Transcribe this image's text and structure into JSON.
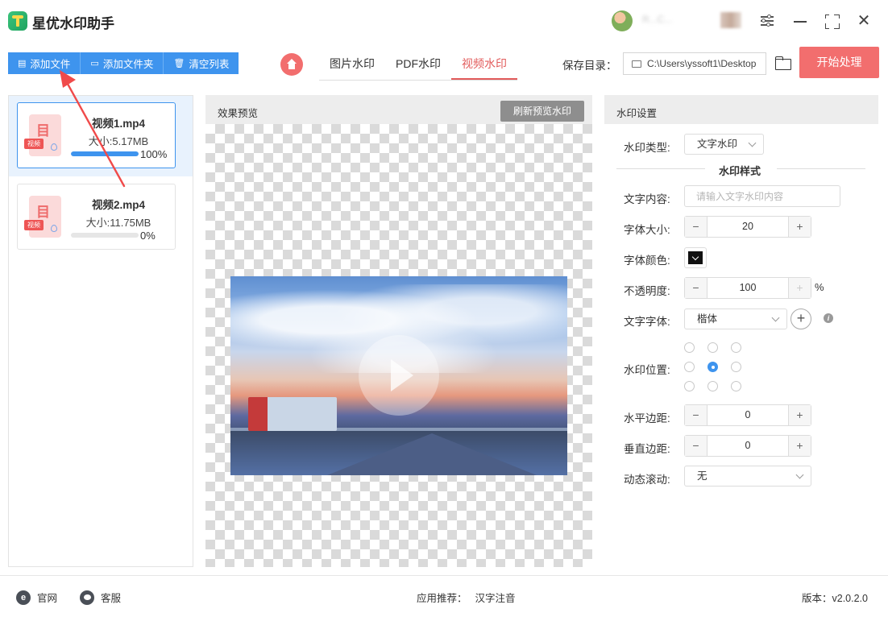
{
  "app": {
    "title": "星优水印助手",
    "username": "R...C..."
  },
  "toolbar": {
    "add_file": "添加文件",
    "add_folder": "添加文件夹",
    "clear_list": "清空列表"
  },
  "tabs": [
    {
      "label": "图片水印",
      "active": false
    },
    {
      "label": "PDF水印",
      "active": false
    },
    {
      "label": "视频水印",
      "active": true
    }
  ],
  "save": {
    "label": "保存目录：",
    "path": "C:\\Users\\yssoft1\\Desktop"
  },
  "start_button": "开始处理",
  "files": [
    {
      "name": "视频1.mp4",
      "size": "大小:5.17MB",
      "progress": 1.0,
      "percent": "100%",
      "badge": "视频"
    },
    {
      "name": "视频2.mp4",
      "size": "大小:11.75MB",
      "progress": 0.0,
      "percent": "0%",
      "badge": "视频"
    }
  ],
  "preview": {
    "title": "效果预览",
    "refresh": "刷新预览水印"
  },
  "settings": {
    "title": "水印设置",
    "type_label": "水印类型:",
    "type_value": "文字水印",
    "style_title": "水印样式",
    "text_label": "文字内容:",
    "text_placeholder": "请输入文字水印内容",
    "font_size_label": "字体大小:",
    "font_size": "20",
    "font_color_label": "字体颜色:",
    "font_color": "#111111",
    "opacity_label": "不透明度:",
    "opacity": "100",
    "opacity_unit": "%",
    "font_label": "文字字体:",
    "font_value": "楷体",
    "position_label": "水印位置:",
    "position_selected": "middle-center",
    "h_margin_label": "水平边距:",
    "h_margin": "0",
    "v_margin_label": "垂直边距:",
    "v_margin": "0",
    "scroll_label": "动态滚动:",
    "scroll_value": "无"
  },
  "footer": {
    "website": "官网",
    "support": "客服",
    "recommend_label": "应用推荐：",
    "recommend_app": "汉字注音",
    "version": "版本：v2.0.2.0"
  },
  "colors": {
    "accent_blue": "#3e94ee",
    "accent_red": "#f26e6e"
  }
}
